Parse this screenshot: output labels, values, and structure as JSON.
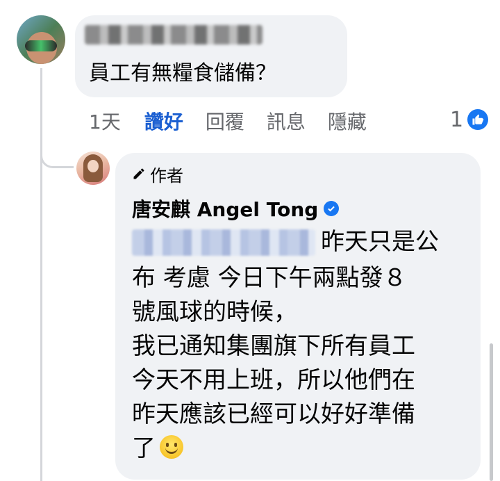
{
  "comment": {
    "text": "員工有無糧食儲備？"
  },
  "actions": {
    "time": "1天",
    "like": "讚好",
    "reply": "回覆",
    "message": "訊息",
    "hide": "隱藏",
    "reaction_count": "1"
  },
  "reply": {
    "author_badge": "作者",
    "author_name": "唐安麒 Angel Tong",
    "first_line": "昨天只是公",
    "lines": [
      "布 考慮 今日下午兩點發８",
      "號風球的時候，",
      "我已通知集團旗下所有員工",
      "今天不用上班，所以他們在",
      "昨天應該已經可以好好準備",
      "了"
    ]
  },
  "colors": {
    "like_active": "#1b5fd1",
    "verified_badge": "#1877f2",
    "bubble_bg": "#f0f2f5",
    "secondary_text": "#65676b"
  },
  "icons": [
    "pen-icon",
    "verified-icon",
    "like-reaction-icon",
    "smiley-emoji-icon"
  ]
}
